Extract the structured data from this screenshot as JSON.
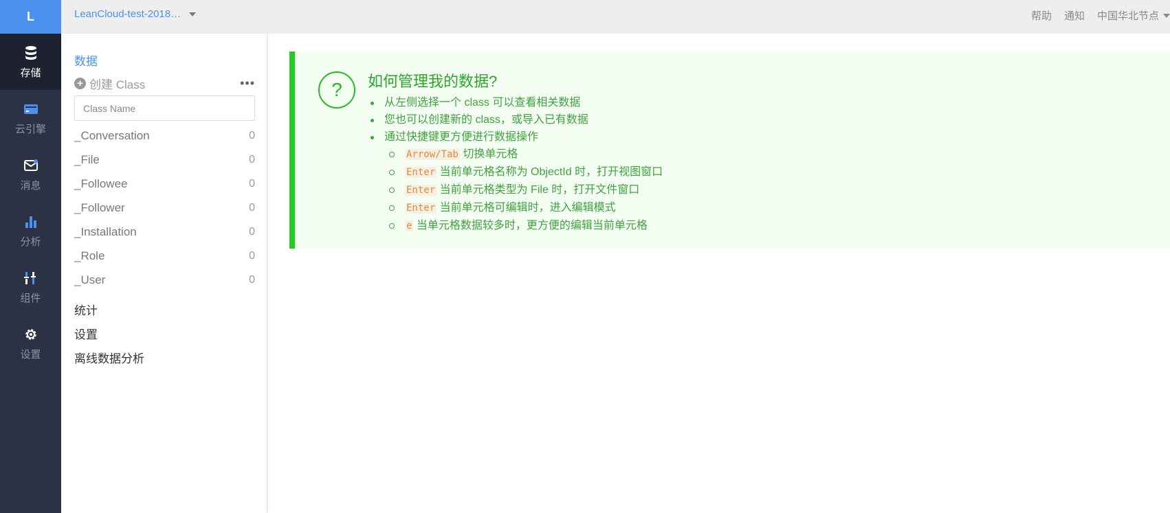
{
  "rail": {
    "logo": "L",
    "items": [
      {
        "label": "存储",
        "icon": "database-icon",
        "active": true
      },
      {
        "label": "云引擎",
        "icon": "server-icon",
        "active": false
      },
      {
        "label": "消息",
        "icon": "message-icon",
        "active": false
      },
      {
        "label": "分析",
        "icon": "bar-chart-icon",
        "active": false
      },
      {
        "label": "组件",
        "icon": "components-icon",
        "active": false
      },
      {
        "label": "设置",
        "icon": "gear-icon",
        "active": false
      }
    ]
  },
  "topbar": {
    "app_name": "LeanCloud-test-2018…",
    "links": {
      "help": "帮助",
      "notify": "通知",
      "region": "中国华北节点"
    }
  },
  "side": {
    "data_title": "数据",
    "create_label": "创建 Class",
    "more": "•••",
    "input_placeholder": "Class Name",
    "classes": [
      {
        "name": "_Conversation",
        "count": "0"
      },
      {
        "name": "_File",
        "count": "0"
      },
      {
        "name": "_Followee",
        "count": "0"
      },
      {
        "name": "_Follower",
        "count": "0"
      },
      {
        "name": "_Installation",
        "count": "0"
      },
      {
        "name": "_Role",
        "count": "0"
      },
      {
        "name": "_User",
        "count": "0"
      }
    ],
    "sections": {
      "stats": "统计",
      "settings": "设置",
      "offline": "离线数据分析"
    }
  },
  "help": {
    "icon": "?",
    "title": "如何管理我的数据?",
    "bullets": [
      "从左侧选择一个 class 可以查看相关数据",
      "您也可以创建新的 class，或导入已有数据",
      "通过快捷键更方便进行数据操作"
    ],
    "shortcuts": [
      {
        "key": "Arrow/Tab",
        "desc": "切换单元格"
      },
      {
        "key": "Enter",
        "desc": "当前单元格名称为 ObjectId 时，打开视图窗口"
      },
      {
        "key": "Enter",
        "desc": "当前单元格类型为 File 时，打开文件窗口"
      },
      {
        "key": "Enter",
        "desc": "当前单元格可编辑时，进入编辑模式"
      },
      {
        "key": "e",
        "desc": "当单元格数据较多时，更方便的编辑当前单元格"
      }
    ]
  },
  "colors": {
    "accent": "#4c91f0",
    "rail_bg": "#2c3144",
    "success": "#22cc22"
  }
}
